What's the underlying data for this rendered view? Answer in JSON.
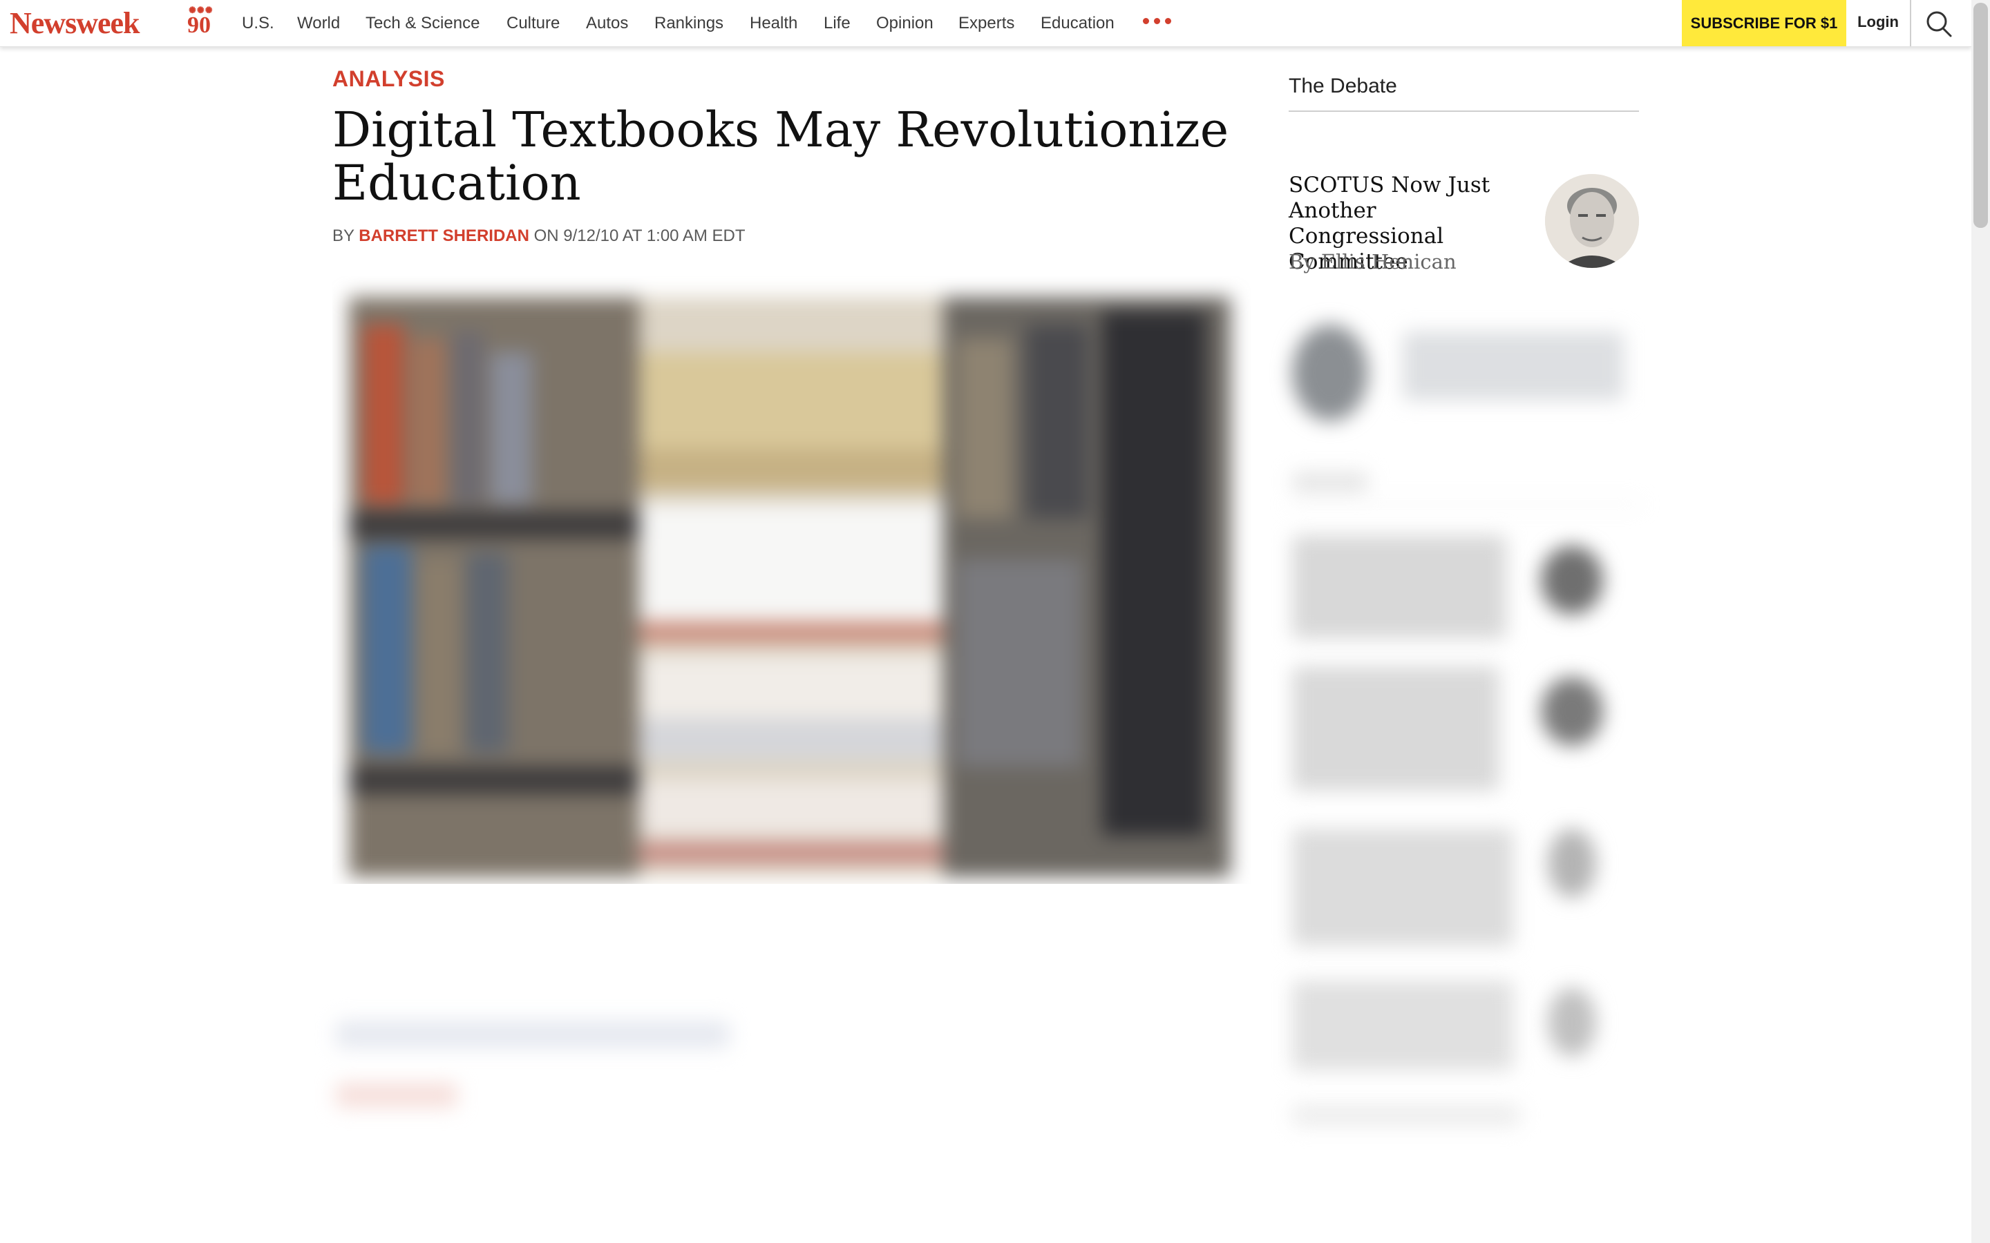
{
  "nav": {
    "logo": "Newsweek",
    "anniversary": "90",
    "items": [
      {
        "label": "U.S."
      },
      {
        "label": "World"
      },
      {
        "label": "Tech & Science"
      },
      {
        "label": "Culture"
      },
      {
        "label": "Autos"
      },
      {
        "label": "Rankings"
      },
      {
        "label": "Health"
      },
      {
        "label": "Life"
      },
      {
        "label": "Opinion"
      },
      {
        "label": "Experts"
      },
      {
        "label": "Education"
      }
    ],
    "more_icon": "more-dots-icon",
    "subscribe": "SUBSCRIBE FOR $1",
    "login": "Login",
    "search_icon": "search-icon"
  },
  "article": {
    "kicker": "ANALYSIS",
    "headline": "Digital Textbooks May Revolutionize Education",
    "by": "BY",
    "author": "BARRETT SHERIDAN",
    "date": "ON 9/12/10 AT 1:00 AM EDT"
  },
  "sidebar": {
    "section_title": "The Debate",
    "featured": {
      "title": "SCOTUS Now Just Another Congressional Committee",
      "author": "By Ellis Henican"
    }
  },
  "colors": {
    "brand_red": "#d23f2d",
    "subscribe_yellow": "#ffe93b"
  }
}
